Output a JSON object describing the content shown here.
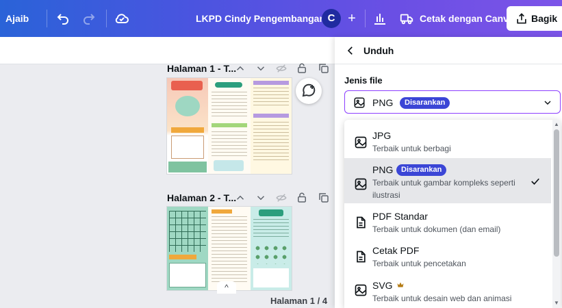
{
  "topbar": {
    "left_label": "Ajaib",
    "doc_title": "LKPD Cindy Pengembangan",
    "avatar_letter": "C",
    "plus_label": "+",
    "print_label": "Cetak dengan Canva",
    "share_label": "Bagik"
  },
  "pages": [
    {
      "title": "Halaman 1 - T..."
    },
    {
      "title": "Halaman 2 - T..."
    }
  ],
  "footer": {
    "page_indicator": "Halaman 1 / 4"
  },
  "panel": {
    "title": "Unduh",
    "file_type_label": "Jenis file",
    "selected": {
      "name": "PNG",
      "badge": "Disarankan"
    }
  },
  "options": [
    {
      "name": "JPG",
      "desc": "Terbaik untuk berbagi",
      "icon": "image-icon",
      "selected": false
    },
    {
      "name": "PNG",
      "badge": "Disarankan",
      "desc": "Terbaik untuk gambar kompleks seperti ilustrasi",
      "icon": "image-icon",
      "selected": true
    },
    {
      "name": "PDF Standar",
      "desc": "Terbaik untuk dokumen (dan email)",
      "icon": "document-icon",
      "selected": false
    },
    {
      "name": "Cetak PDF",
      "desc": "Terbaik untuk pencetakan",
      "icon": "document-icon",
      "selected": false
    },
    {
      "name": "SVG",
      "desc": "Terbaik untuk desain web dan animasi",
      "icon": "image-icon",
      "pro": true,
      "selected": false
    }
  ],
  "colors": {
    "accent": "#8b3dff",
    "badge": "#3b46d6",
    "topbar_start": "#2a63d8",
    "topbar_end": "#7c54e8"
  }
}
